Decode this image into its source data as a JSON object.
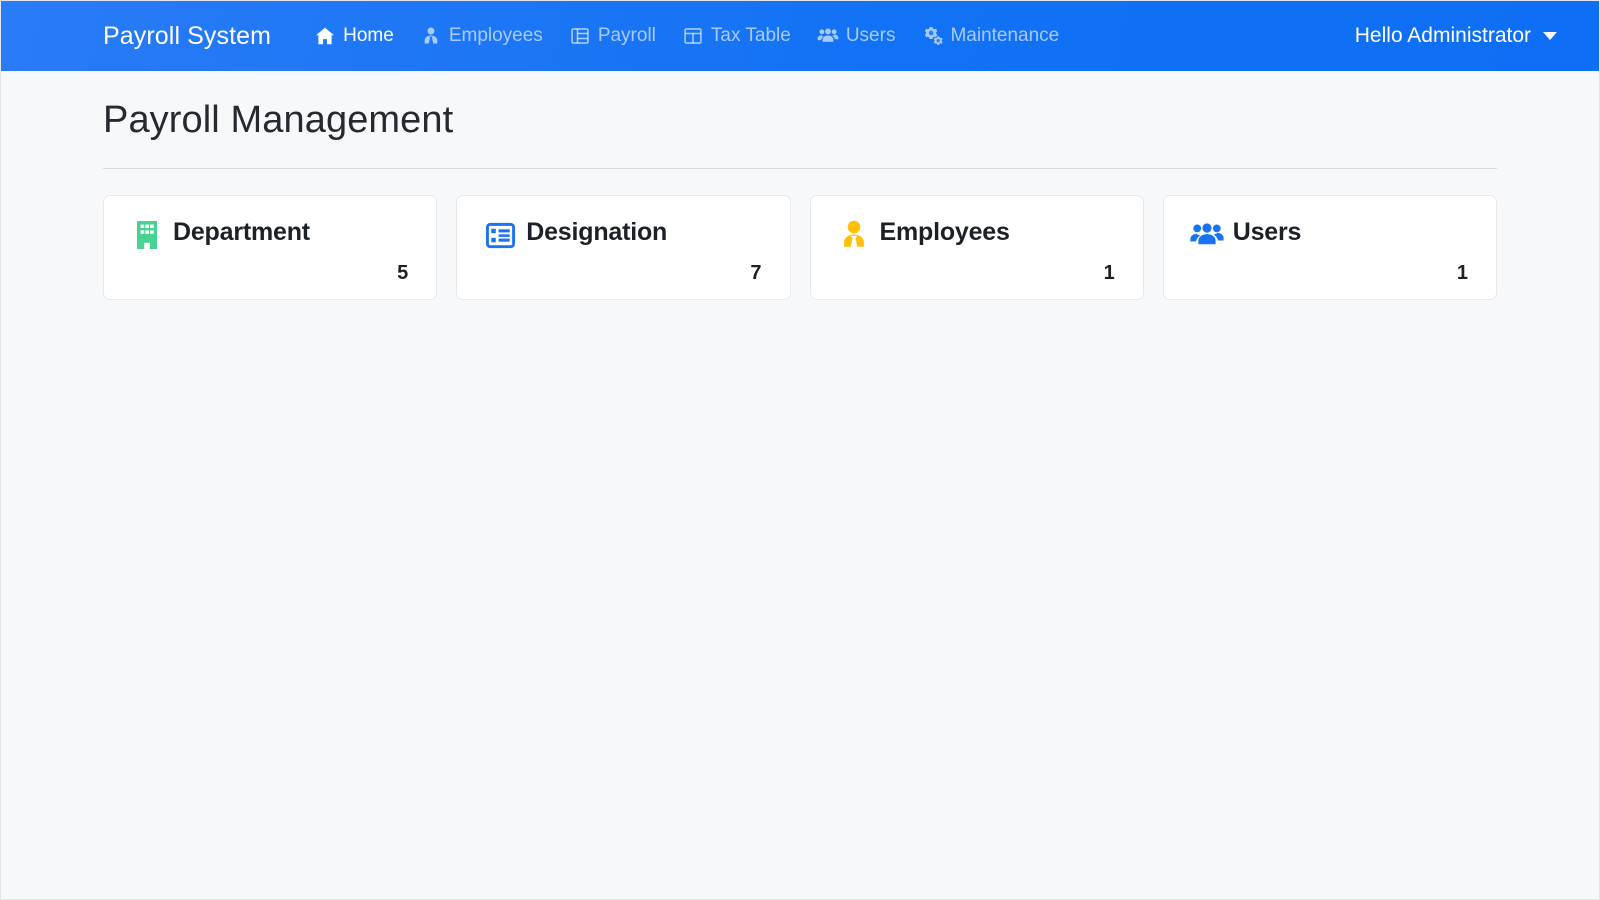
{
  "navbar": {
    "brand": "Payroll System",
    "items": [
      {
        "label": "Home",
        "icon": "home-icon",
        "active": true
      },
      {
        "label": "Employees",
        "icon": "user-tie-icon",
        "active": false
      },
      {
        "label": "Payroll",
        "icon": "table-list-icon",
        "active": false
      },
      {
        "label": "Tax Table",
        "icon": "table-grid-icon",
        "active": false
      },
      {
        "label": "Users",
        "icon": "users-icon",
        "active": false
      },
      {
        "label": "Maintenance",
        "icon": "cogs-icon",
        "active": false
      }
    ],
    "user_menu": {
      "label": "Hello Administrator",
      "caret_icon": "chevron-down-icon"
    },
    "background_color": "#1272f5"
  },
  "main": {
    "page_title": "Payroll Management",
    "cards": [
      {
        "title": "Department",
        "count": "5",
        "icon": "building-icon",
        "icon_color": "#4ad295"
      },
      {
        "title": "Designation",
        "count": "7",
        "icon": "list-alt-icon",
        "icon_color": "#1a73f0"
      },
      {
        "title": "Employees",
        "count": "1",
        "icon": "user-tie-icon",
        "icon_color": "#ffc107"
      },
      {
        "title": "Users",
        "count": "1",
        "icon": "users-icon",
        "icon_color": "#1a73f0"
      }
    ]
  }
}
